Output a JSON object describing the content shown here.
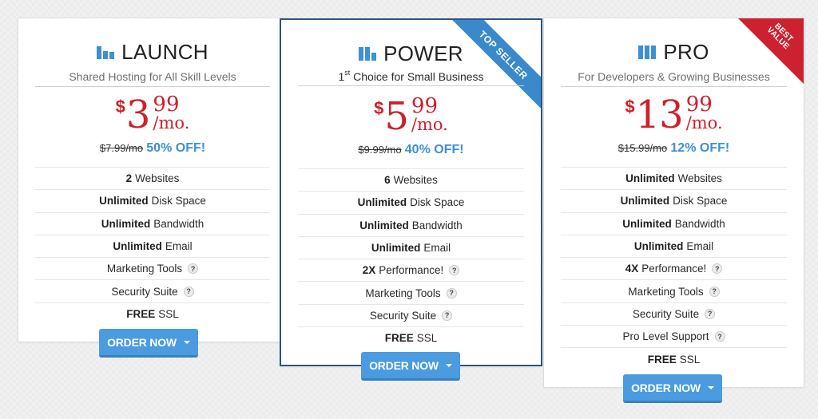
{
  "plans": [
    {
      "id": "launch",
      "name": "LAUNCH",
      "icon": "bar-chart-ascending-icon",
      "subtitle": "Shared Hosting for All Skill Levels",
      "price": {
        "currency": "$",
        "dollars": "3",
        "cents": "99",
        "per": "/mo."
      },
      "original_price": "$7.99/mo",
      "discount": "50% OFF!",
      "features": [
        {
          "bold": "2",
          "text": "Websites",
          "help": false
        },
        {
          "bold": "Unlimited",
          "text": "Disk Space",
          "help": false
        },
        {
          "bold": "Unlimited",
          "text": "Bandwidth",
          "help": false
        },
        {
          "bold": "Unlimited",
          "text": "Email",
          "help": false
        },
        {
          "bold": "",
          "text": "Marketing Tools",
          "help": true
        },
        {
          "bold": "",
          "text": "Security Suite",
          "help": true
        },
        {
          "bold": "FREE",
          "text": "SSL",
          "help": false
        }
      ],
      "button_label": "ORDER NOW"
    },
    {
      "id": "power",
      "name": "POWER",
      "icon": "bar-chart-descending-icon",
      "subtitle_sup": "st",
      "subtitle_prefix": "1",
      "subtitle": "Choice for Small Business",
      "ribbon": "TOP SELLER",
      "price": {
        "currency": "$",
        "dollars": "5",
        "cents": "99",
        "per": "/mo."
      },
      "original_price": "$9.99/mo",
      "discount": "40% OFF!",
      "features": [
        {
          "bold": "6",
          "text": "Websites",
          "help": false
        },
        {
          "bold": "Unlimited",
          "text": "Disk Space",
          "help": false
        },
        {
          "bold": "Unlimited",
          "text": "Bandwidth",
          "help": false
        },
        {
          "bold": "Unlimited",
          "text": "Email",
          "help": false
        },
        {
          "bold": "2X",
          "text": "Performance!",
          "help": true
        },
        {
          "bold": "",
          "text": "Marketing Tools",
          "help": true
        },
        {
          "bold": "",
          "text": "Security Suite",
          "help": true
        },
        {
          "bold": "FREE",
          "text": "SSL",
          "help": false
        }
      ],
      "button_label": "ORDER NOW"
    },
    {
      "id": "pro",
      "name": "PRO",
      "icon": "bar-chart-full-icon",
      "subtitle": "For Developers & Growing Businesses",
      "corner_badge": [
        "BEST",
        "VALUE"
      ],
      "price": {
        "currency": "$",
        "dollars": "13",
        "cents": "99",
        "per": "/mo."
      },
      "original_price": "$15.99/mo",
      "discount": "12% OFF!",
      "features": [
        {
          "bold": "Unlimited",
          "text": "Websites",
          "help": false
        },
        {
          "bold": "Unlimited",
          "text": "Disk Space",
          "help": false
        },
        {
          "bold": "Unlimited",
          "text": "Bandwidth",
          "help": false
        },
        {
          "bold": "Unlimited",
          "text": "Email",
          "help": false
        },
        {
          "bold": "4X",
          "text": "Performance!",
          "help": true
        },
        {
          "bold": "",
          "text": "Marketing Tools",
          "help": true
        },
        {
          "bold": "",
          "text": "Security Suite",
          "help": true
        },
        {
          "bold": "",
          "text": "Pro Level Support",
          "help": true
        },
        {
          "bold": "FREE",
          "text": "SSL",
          "help": false
        }
      ],
      "button_label": "ORDER NOW"
    }
  ],
  "help_glyph": "?",
  "colors": {
    "accent_blue": "#3d8fd6",
    "price_red": "#cf1f2c",
    "featured_border": "#2d5580",
    "button_blue": "#4a9be0",
    "ribbon_blue": "#3a89cc",
    "badge_red": "#cc2230"
  }
}
